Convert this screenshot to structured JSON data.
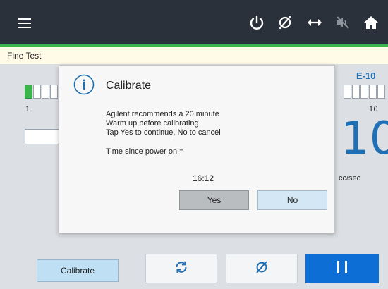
{
  "header": {
    "icons": [
      "menu-icon",
      "power-icon",
      "zero-icon",
      "horizontal-arrows-icon",
      "mute-icon",
      "home-icon"
    ],
    "accent_color": "#39b54a",
    "bar_color": "#2a313b"
  },
  "title_strip": {
    "label": "Fine Test"
  },
  "background": {
    "bar_scale_min": "1",
    "bar_scale_max": "10",
    "bar_level_fraction": 0.1,
    "exponent": "E-10",
    "reading": "10",
    "unit": "cc/sec"
  },
  "dialog": {
    "title": "Calibrate",
    "message_lines": [
      "Agilent recommends a 20 minute",
      "Warm up before calibrating",
      "Tap Yes to continue, No to cancel"
    ],
    "elapsed_label": "Time since power on =",
    "elapsed_value": "16:12",
    "yes_label": "Yes",
    "no_label": "No"
  },
  "bottom_bar": {
    "calibrate_label": "Calibrate",
    "icons": [
      "refresh-icon",
      "zero-icon",
      "pause-icon"
    ]
  }
}
